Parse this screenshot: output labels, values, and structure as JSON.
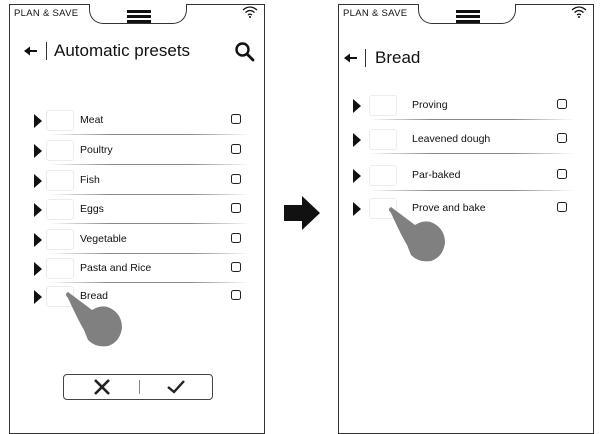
{
  "colors": {
    "hand": "#808080",
    "arrow": "#111111",
    "border": "#333333"
  },
  "left_screen": {
    "brand": "PLAN & SAVE",
    "icons": {
      "wifi": "wifi-icon",
      "menu": "hamburger-icon",
      "back": "back-arrow-icon",
      "search": "search-icon"
    },
    "title": "Automatic presets",
    "items": [
      {
        "label": "Meat",
        "checked": false
      },
      {
        "label": "Poultry",
        "checked": false
      },
      {
        "label": "Fish",
        "checked": false
      },
      {
        "label": "Eggs",
        "checked": false
      },
      {
        "label": "Vegetable",
        "checked": false
      },
      {
        "label": "Pasta and Rice",
        "checked": false
      },
      {
        "label": "Bread",
        "checked": false
      }
    ],
    "actions": {
      "cancel": "close-icon",
      "confirm": "check-icon"
    }
  },
  "right_screen": {
    "brand": "PLAN & SAVE",
    "icons": {
      "wifi": "wifi-icon",
      "menu": "hamburger-icon",
      "back": "back-arrow-icon"
    },
    "title": "Bread",
    "items": [
      {
        "label": "Proving",
        "checked": false
      },
      {
        "label": "Leavened dough",
        "checked": false
      },
      {
        "label": "Par-baked",
        "checked": false
      },
      {
        "label": "Prove and bake",
        "checked": false
      }
    ]
  },
  "transition_icon": "right-arrow-icon",
  "gesture_icon": "tap-hand-icon"
}
